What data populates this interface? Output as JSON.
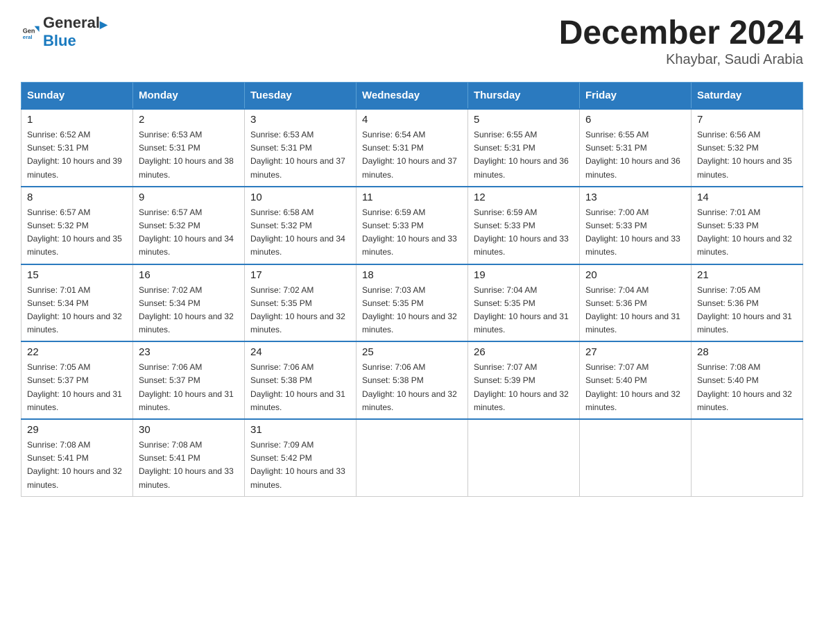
{
  "header": {
    "logo_general": "General",
    "logo_blue": "Blue",
    "title": "December 2024",
    "location": "Khaybar, Saudi Arabia"
  },
  "weekdays": [
    "Sunday",
    "Monday",
    "Tuesday",
    "Wednesday",
    "Thursday",
    "Friday",
    "Saturday"
  ],
  "weeks": [
    [
      {
        "day": "1",
        "sunrise": "6:52 AM",
        "sunset": "5:31 PM",
        "daylight": "10 hours and 39 minutes."
      },
      {
        "day": "2",
        "sunrise": "6:53 AM",
        "sunset": "5:31 PM",
        "daylight": "10 hours and 38 minutes."
      },
      {
        "day": "3",
        "sunrise": "6:53 AM",
        "sunset": "5:31 PM",
        "daylight": "10 hours and 37 minutes."
      },
      {
        "day": "4",
        "sunrise": "6:54 AM",
        "sunset": "5:31 PM",
        "daylight": "10 hours and 37 minutes."
      },
      {
        "day": "5",
        "sunrise": "6:55 AM",
        "sunset": "5:31 PM",
        "daylight": "10 hours and 36 minutes."
      },
      {
        "day": "6",
        "sunrise": "6:55 AM",
        "sunset": "5:31 PM",
        "daylight": "10 hours and 36 minutes."
      },
      {
        "day": "7",
        "sunrise": "6:56 AM",
        "sunset": "5:32 PM",
        "daylight": "10 hours and 35 minutes."
      }
    ],
    [
      {
        "day": "8",
        "sunrise": "6:57 AM",
        "sunset": "5:32 PM",
        "daylight": "10 hours and 35 minutes."
      },
      {
        "day": "9",
        "sunrise": "6:57 AM",
        "sunset": "5:32 PM",
        "daylight": "10 hours and 34 minutes."
      },
      {
        "day": "10",
        "sunrise": "6:58 AM",
        "sunset": "5:32 PM",
        "daylight": "10 hours and 34 minutes."
      },
      {
        "day": "11",
        "sunrise": "6:59 AM",
        "sunset": "5:33 PM",
        "daylight": "10 hours and 33 minutes."
      },
      {
        "day": "12",
        "sunrise": "6:59 AM",
        "sunset": "5:33 PM",
        "daylight": "10 hours and 33 minutes."
      },
      {
        "day": "13",
        "sunrise": "7:00 AM",
        "sunset": "5:33 PM",
        "daylight": "10 hours and 33 minutes."
      },
      {
        "day": "14",
        "sunrise": "7:01 AM",
        "sunset": "5:33 PM",
        "daylight": "10 hours and 32 minutes."
      }
    ],
    [
      {
        "day": "15",
        "sunrise": "7:01 AM",
        "sunset": "5:34 PM",
        "daylight": "10 hours and 32 minutes."
      },
      {
        "day": "16",
        "sunrise": "7:02 AM",
        "sunset": "5:34 PM",
        "daylight": "10 hours and 32 minutes."
      },
      {
        "day": "17",
        "sunrise": "7:02 AM",
        "sunset": "5:35 PM",
        "daylight": "10 hours and 32 minutes."
      },
      {
        "day": "18",
        "sunrise": "7:03 AM",
        "sunset": "5:35 PM",
        "daylight": "10 hours and 32 minutes."
      },
      {
        "day": "19",
        "sunrise": "7:04 AM",
        "sunset": "5:35 PM",
        "daylight": "10 hours and 31 minutes."
      },
      {
        "day": "20",
        "sunrise": "7:04 AM",
        "sunset": "5:36 PM",
        "daylight": "10 hours and 31 minutes."
      },
      {
        "day": "21",
        "sunrise": "7:05 AM",
        "sunset": "5:36 PM",
        "daylight": "10 hours and 31 minutes."
      }
    ],
    [
      {
        "day": "22",
        "sunrise": "7:05 AM",
        "sunset": "5:37 PM",
        "daylight": "10 hours and 31 minutes."
      },
      {
        "day": "23",
        "sunrise": "7:06 AM",
        "sunset": "5:37 PM",
        "daylight": "10 hours and 31 minutes."
      },
      {
        "day": "24",
        "sunrise": "7:06 AM",
        "sunset": "5:38 PM",
        "daylight": "10 hours and 31 minutes."
      },
      {
        "day": "25",
        "sunrise": "7:06 AM",
        "sunset": "5:38 PM",
        "daylight": "10 hours and 32 minutes."
      },
      {
        "day": "26",
        "sunrise": "7:07 AM",
        "sunset": "5:39 PM",
        "daylight": "10 hours and 32 minutes."
      },
      {
        "day": "27",
        "sunrise": "7:07 AM",
        "sunset": "5:40 PM",
        "daylight": "10 hours and 32 minutes."
      },
      {
        "day": "28",
        "sunrise": "7:08 AM",
        "sunset": "5:40 PM",
        "daylight": "10 hours and 32 minutes."
      }
    ],
    [
      {
        "day": "29",
        "sunrise": "7:08 AM",
        "sunset": "5:41 PM",
        "daylight": "10 hours and 32 minutes."
      },
      {
        "day": "30",
        "sunrise": "7:08 AM",
        "sunset": "5:41 PM",
        "daylight": "10 hours and 33 minutes."
      },
      {
        "day": "31",
        "sunrise": "7:09 AM",
        "sunset": "5:42 PM",
        "daylight": "10 hours and 33 minutes."
      },
      null,
      null,
      null,
      null
    ]
  ]
}
